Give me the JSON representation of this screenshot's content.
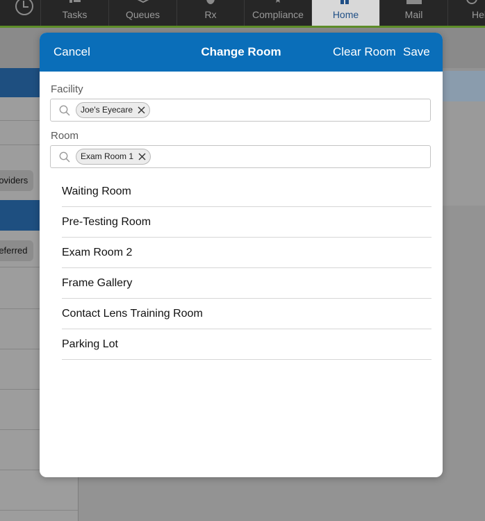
{
  "nav": {
    "items": [
      {
        "label": "Tasks"
      },
      {
        "label": "Queues"
      },
      {
        "label": "Rx"
      },
      {
        "label": "Compliance"
      },
      {
        "label": "Home"
      },
      {
        "label": "Mail"
      },
      {
        "label": "Hel"
      }
    ],
    "active": "Home"
  },
  "background": {
    "chip1": "roviders",
    "chip2": "referred"
  },
  "modal": {
    "cancel_label": "Cancel",
    "title": "Change Room",
    "clear_label": "Clear Room",
    "save_label": "Save",
    "facility": {
      "label": "Facility",
      "selected": "Joe's Eyecare"
    },
    "room": {
      "label": "Room",
      "selected": "Exam Room 1"
    },
    "rooms": [
      "Waiting Room",
      "Pre-Testing Room",
      "Exam Room 2",
      "Frame Gallery",
      "Contact Lens Training Room",
      "Parking Lot"
    ]
  },
  "colors": {
    "header_blue": "#0a6eb9",
    "nav_dark": "#262626",
    "nav_accent_green": "#5d8d28",
    "active_tab_text": "#1f4f86"
  }
}
